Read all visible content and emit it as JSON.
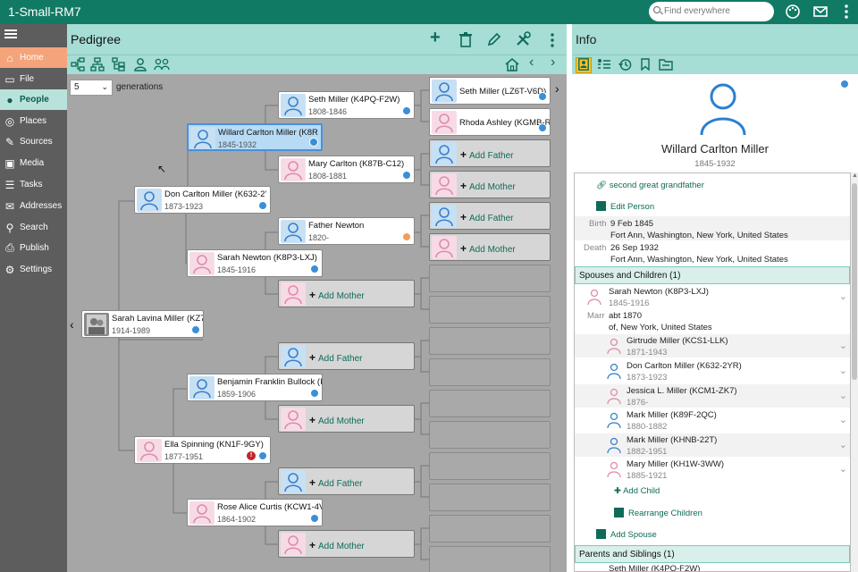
{
  "app": {
    "title": "1-Small-RM7"
  },
  "search": {
    "placeholder": "Find everywhere"
  },
  "sidebar": {
    "items": [
      {
        "label": "Home",
        "icon": "home-icon"
      },
      {
        "label": "File",
        "icon": "file-icon"
      },
      {
        "label": "People",
        "icon": "person-icon"
      },
      {
        "label": "Places",
        "icon": "globe-icon"
      },
      {
        "label": "Sources",
        "icon": "source-icon"
      },
      {
        "label": "Media",
        "icon": "media-icon"
      },
      {
        "label": "Tasks",
        "icon": "tasks-icon"
      },
      {
        "label": "Addresses",
        "icon": "addresses-icon"
      },
      {
        "label": "Search",
        "icon": "search-icon"
      },
      {
        "label": "Publish",
        "icon": "publish-icon"
      },
      {
        "label": "Settings",
        "icon": "settings-icon"
      }
    ]
  },
  "pedigree": {
    "title": "Pedigree",
    "generations_value": "5",
    "generations_label": "generations",
    "people": {
      "root": {
        "name": "Sarah Lavina Miller (KZ7",
        "dates": "1914-1989"
      },
      "father": {
        "name": "Don Carlton Miller (K632-2’",
        "dates": "1873-1923"
      },
      "mother": {
        "name": "Ella Spinning (KN1F-9GY)",
        "dates": "1877-1951"
      },
      "pf": {
        "name": "Willard Carlton Miller (K8R",
        "dates": "1845-1932"
      },
      "pm": {
        "name": "Sarah Newton (K8P3-LXJ)",
        "dates": "1845-1916"
      },
      "mf": {
        "name": "Benjamin Franklin Bullock (I",
        "dates": "1859-1906"
      },
      "mm": {
        "name": "Rose Alice Curtis (KCW1-4V",
        "dates": "1864-1902"
      },
      "pff": {
        "name": "Seth Miller (K4PQ-F2W)",
        "dates": "1808-1846"
      },
      "pfm": {
        "name": "Mary Carlton (K87B-C12)",
        "dates": "1808-1881"
      },
      "pmf": {
        "name": "Father Newton",
        "dates": "1820-"
      },
      "pfff": {
        "name": "Seth Miller (LZ6T-V6D)",
        "dates": ""
      },
      "pffm": {
        "name": "Rhoda Ashley (KGMB-R",
        "dates": ""
      }
    },
    "add_father": "Add Father",
    "add_mother": "Add Mother"
  },
  "info": {
    "title": "Info",
    "person_name": "Willard Carlton Miller",
    "person_dates": "1845-1932",
    "relationship": "second great grandfather",
    "edit_person": "Edit Person",
    "birth_label": "Birth",
    "birth_date": "9 Feb 1845",
    "birth_place": "Fort Ann, Washington, New York, United States",
    "death_label": "Death",
    "death_date": "26 Sep 1932",
    "death_place": "Fort Ann, Washington, New York, United States",
    "spouses_header": "Spouses and Children (1)",
    "spouse": {
      "name": "Sarah Newton (K8P3-LXJ)",
      "dates": "1845-1916"
    },
    "marr_label": "Marr",
    "marr_date": "abt 1870",
    "marr_place": "of, New York, United States",
    "children": [
      {
        "name": "Girtrude Miller (KCS1-LLK)",
        "dates": "1871-1943",
        "sex": "f"
      },
      {
        "name": "Don Carlton Miller (K632-2YR)",
        "dates": "1873-1923",
        "sex": "m"
      },
      {
        "name": "Jessica L. Miller (KCM1-ZK7)",
        "dates": "1876-",
        "sex": "f"
      },
      {
        "name": "Mark Miller (K89F-2QC)",
        "dates": "1880-1882",
        "sex": "m"
      },
      {
        "name": "Mark Miller (KHNB-22T)",
        "dates": "1882-1951",
        "sex": "m"
      },
      {
        "name": "Mary Miller (KH1W-3WW)",
        "dates": "1885-1921",
        "sex": "f"
      }
    ],
    "add_child": "Add Child",
    "rearrange_children": "Rearrange Children",
    "add_spouse": "Add Spouse",
    "parents_header": "Parents and Siblings (1)",
    "parent_partial": "Seth Miller (K4PQ-F2W)"
  },
  "colors": {
    "accent": "#117a65",
    "header": "#a6ddd4",
    "sidebar": "#5d5d5d",
    "home": "#f4a37a",
    "selected": "#b7dbf5"
  }
}
